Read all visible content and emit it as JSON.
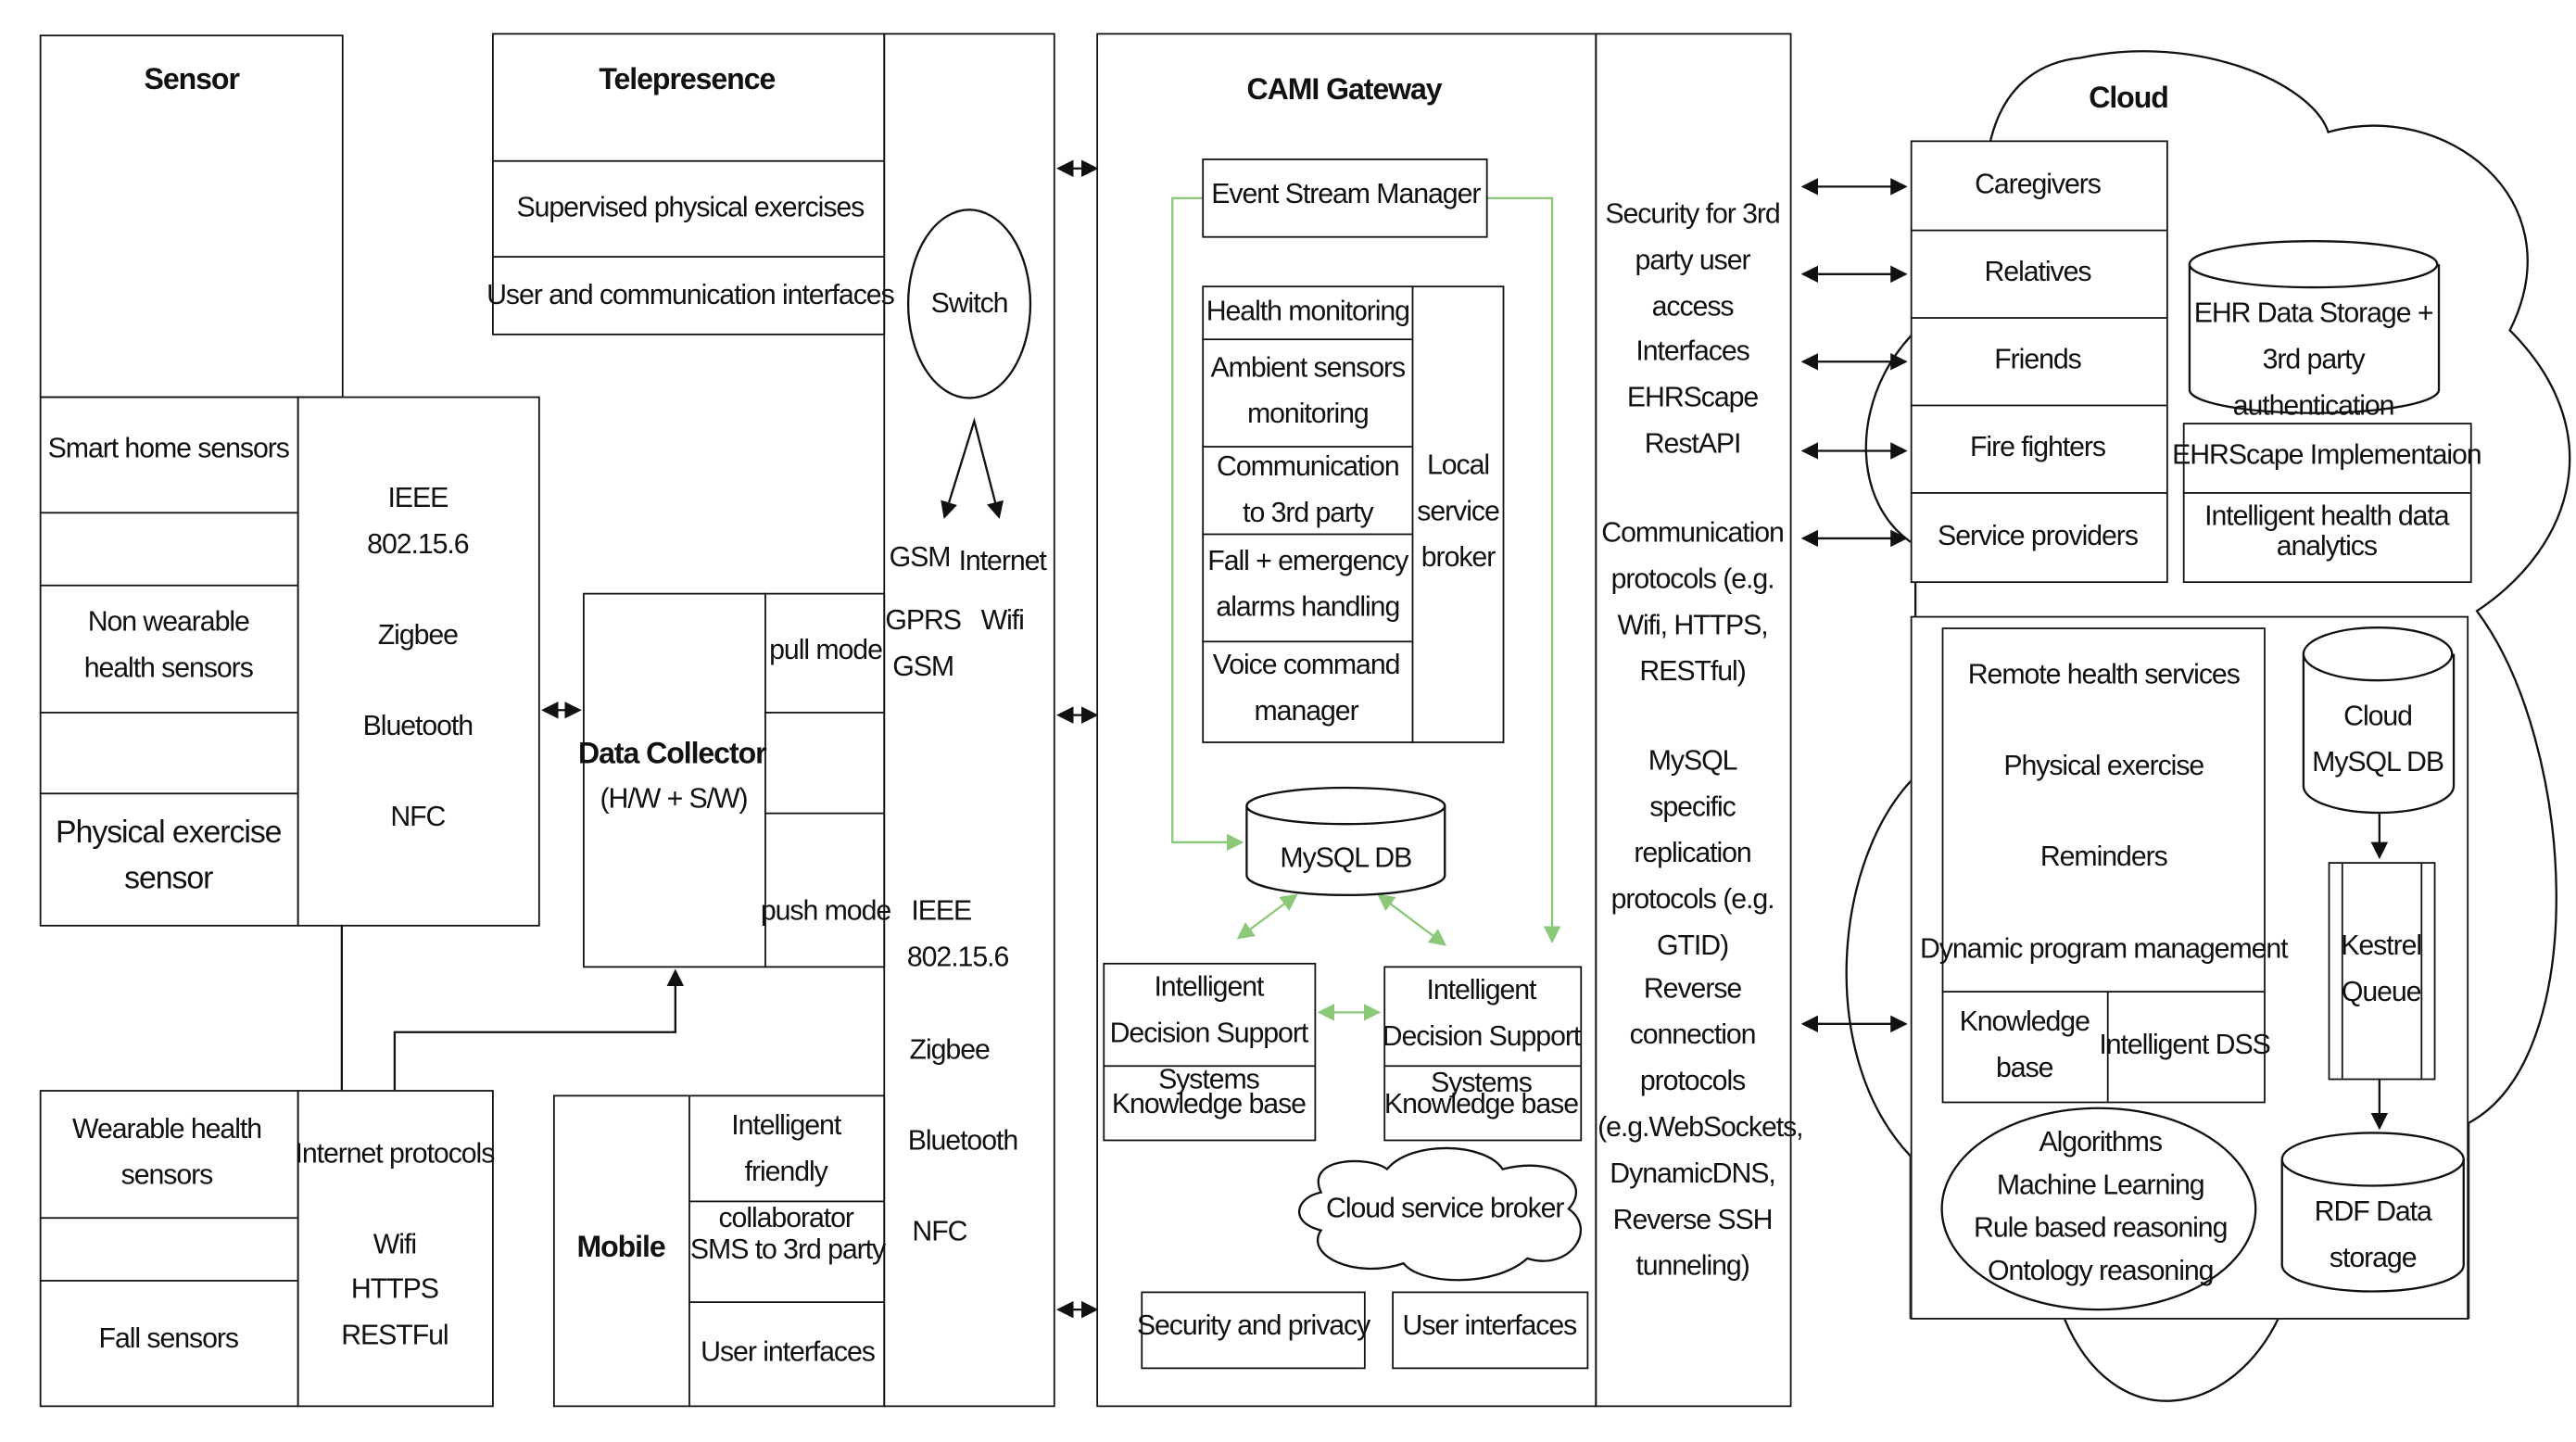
{
  "sensor": {
    "title": "Sensor",
    "items": [
      "Smart home sensors",
      "Non wearable health sensors",
      "Physical exercise sensor"
    ],
    "protocols": [
      "IEEE 802.15.6",
      "Zigbee",
      "Bluetooth",
      "NFC"
    ],
    "wearable": [
      "Wearable health sensors",
      "Fall sensors"
    ],
    "internet": {
      "title": "Internet protocols",
      "items": [
        "Wifi",
        "HTTPS",
        "RESTFul"
      ]
    }
  },
  "data_collector": {
    "title": "Data Collector",
    "subtitle": "(H/W + S/W)",
    "pull": "pull mode",
    "push": "push mode"
  },
  "telepresence": {
    "title": "Telepresence",
    "items": [
      "Supervised physical exercises",
      "User and communication interfaces"
    ]
  },
  "switch": {
    "label": "Switch",
    "gsm": "GSM",
    "internet": "Internet",
    "gprs": "GPRS",
    "wifi": "Wifi",
    "gsm2": "GSM",
    "protocols": [
      "IEEE",
      "802.15.6",
      "Zigbee",
      "Bluetooth",
      "NFC"
    ]
  },
  "mobile": {
    "title": "Mobile",
    "items": [
      "Intelligent friendly collaborator",
      "SMS to 3rd party",
      "User interfaces"
    ]
  },
  "gateway": {
    "title": "CAMI Gateway",
    "event_stream": "Event Stream Manager",
    "services": [
      "Health monitoring",
      "Ambient sensors monitoring",
      "Communication to 3rd party",
      "Fall + emergency alarms handling",
      "Voice command manager"
    ],
    "broker": "Local service broker",
    "mysql": "MySQL DB",
    "idss": "Intelligent Decision Support Systems",
    "kb": "Knowledge base",
    "cloud_broker": "Cloud service broker",
    "security": "Security and privacy",
    "ui": "User interfaces",
    "interfaces": [
      "Security for 3rd party user access",
      "Interfaces EHRScape RestAPI",
      "Communication protocols (e.g. Wifi, HTTPS, RESTful)",
      "MySQL specific replication protocols (e.g. GTID)",
      "Reverse connection protocols (e.g.WebSockets, DynamicDNS, Reverse SSH tunneling)"
    ]
  },
  "cloud": {
    "title": "Cloud",
    "users": [
      "Caregivers",
      "Relatives",
      "Friends",
      "Fire fighters",
      "Service providers"
    ],
    "ehr": "EHR Data Storage + 3rd party authentication",
    "ehrscape": "EHRScape Implementaion",
    "analytics": "Intelligent health data analytics",
    "services": [
      "Remote health services",
      "Physical exercise",
      "Reminders",
      "Dynamic program management"
    ],
    "kb": "Knowledge base",
    "dss": "Intelligent DSS",
    "algorithms": [
      "Algorithms",
      "Machine Learning",
      "Rule based reasoning",
      "Ontology reasoning"
    ],
    "mysql": "Cloud MySQL DB",
    "kestrel": "Kestrel Queue",
    "rdf": "RDF Data storage"
  },
  "colors": {
    "line": "#111111",
    "green_flow": "#8cc87a"
  }
}
